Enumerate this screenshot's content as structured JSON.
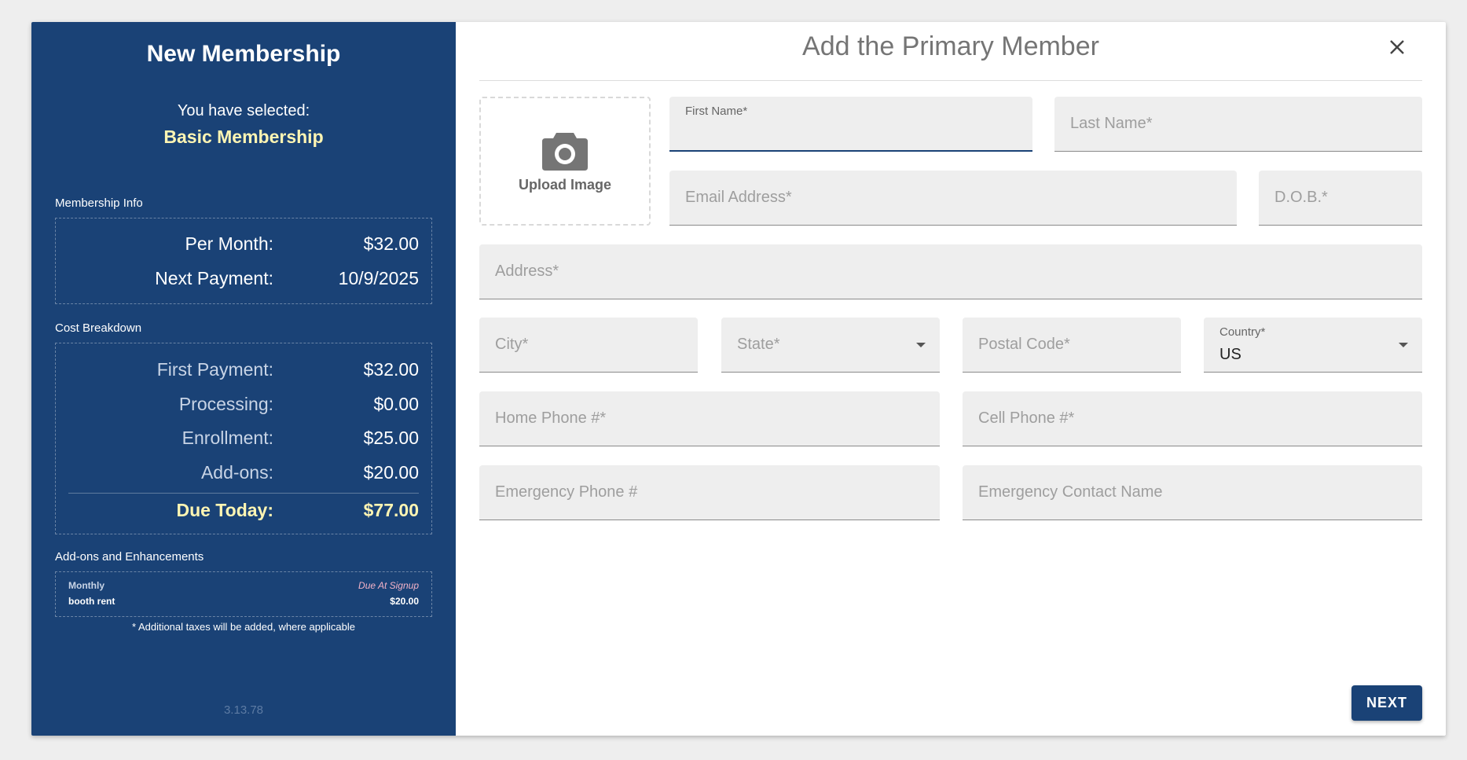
{
  "sidebar": {
    "title": "New Membership",
    "selected_label": "You have selected:",
    "selected_value": "Basic Membership",
    "membership_info_label": "Membership Info",
    "membership_info": [
      {
        "label": "Per Month:",
        "value": "$32.00"
      },
      {
        "label": "Next Payment:",
        "value": "10/9/2025"
      }
    ],
    "cost_breakdown_label": "Cost Breakdown",
    "cost_breakdown": [
      {
        "label": "First Payment:",
        "value": "$32.00"
      },
      {
        "label": "Processing:",
        "value": "$0.00"
      },
      {
        "label": "Enrollment:",
        "value": "$25.00"
      },
      {
        "label": "Add-ons:",
        "value": "$20.00"
      }
    ],
    "due_today": {
      "label": "Due Today:",
      "value": "$77.00"
    },
    "addons_label": "Add-ons and Enhancements",
    "addon": {
      "frequency": "Monthly",
      "due": "Due At Signup",
      "name": "booth rent",
      "price": "$20.00"
    },
    "tax_note": "* Additional taxes will be added, where applicable",
    "version": "3.13.78"
  },
  "main": {
    "title": "Add the Primary Member",
    "upload_label": "Upload Image",
    "fields": {
      "first_name": {
        "label": "First Name*",
        "value": ""
      },
      "last_name": {
        "placeholder": "Last Name*"
      },
      "email": {
        "placeholder": "Email Address*"
      },
      "dob": {
        "placeholder": "D.O.B.*"
      },
      "address": {
        "placeholder": "Address*"
      },
      "city": {
        "placeholder": "City*"
      },
      "state": {
        "placeholder": "State*"
      },
      "postal_code": {
        "placeholder": "Postal Code*"
      },
      "country": {
        "label": "Country*",
        "value": "US"
      },
      "home_phone": {
        "placeholder": "Home Phone #*"
      },
      "cell_phone": {
        "placeholder": "Cell Phone #*"
      },
      "emergency_phone": {
        "placeholder": "Emergency Phone #"
      },
      "emergency_contact": {
        "placeholder": "Emergency Contact Name"
      }
    },
    "next_label": "NEXT"
  },
  "colors": {
    "sidebar_bg": "#1a4276",
    "highlight": "#fff5b3",
    "accent": "#1a4276"
  },
  "icons": {
    "close": "close-icon",
    "upload": "camera-icon",
    "dropdown": "caret-down-icon"
  }
}
